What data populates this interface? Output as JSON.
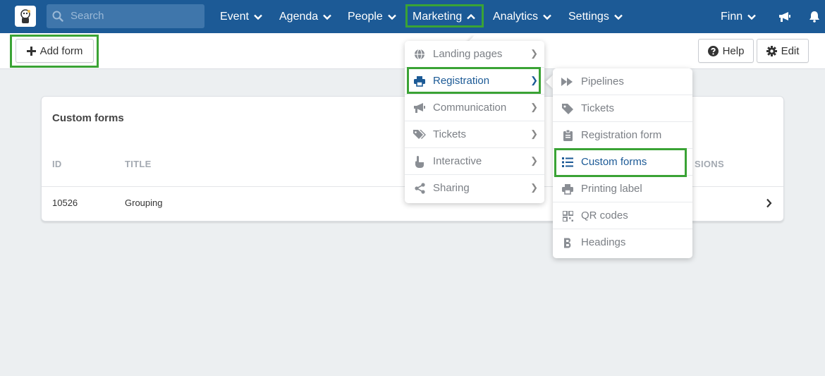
{
  "search": {
    "placeholder": "Search"
  },
  "nav": {
    "event": "Event",
    "agenda": "Agenda",
    "people": "People",
    "marketing": "Marketing",
    "analytics": "Analytics",
    "settings": "Settings",
    "user": "Finn"
  },
  "toolbar": {
    "add_form": "Add form",
    "help": "Help",
    "edit": "Edit"
  },
  "card": {
    "title": "Custom forms",
    "columns": {
      "id": "ID",
      "title": "TITLE",
      "last": "SIONS"
    },
    "rows": [
      {
        "id": "10526",
        "title": "Grouping"
      }
    ]
  },
  "marketing_menu": [
    {
      "label": "Landing pages",
      "icon": "globe-icon"
    },
    {
      "label": "Registration",
      "icon": "printer-icon"
    },
    {
      "label": "Communication",
      "icon": "megaphone-icon"
    },
    {
      "label": "Tickets",
      "icon": "tags-icon"
    },
    {
      "label": "Interactive",
      "icon": "hand-pointer-icon"
    },
    {
      "label": "Sharing",
      "icon": "share-icon"
    }
  ],
  "registration_menu": [
    {
      "label": "Pipelines",
      "icon": "fast-forward-icon"
    },
    {
      "label": "Tickets",
      "icon": "tag-icon"
    },
    {
      "label": "Registration form",
      "icon": "clipboard-icon"
    },
    {
      "label": "Custom forms",
      "icon": "list-icon"
    },
    {
      "label": "Printing label",
      "icon": "printer-icon"
    },
    {
      "label": "QR codes",
      "icon": "qrcode-icon"
    },
    {
      "label": "Headings",
      "icon": "bold-icon"
    }
  ],
  "colors": {
    "nav_bg": "#1c5a96",
    "highlight": "#3aa335",
    "active_text": "#1c5a96"
  }
}
